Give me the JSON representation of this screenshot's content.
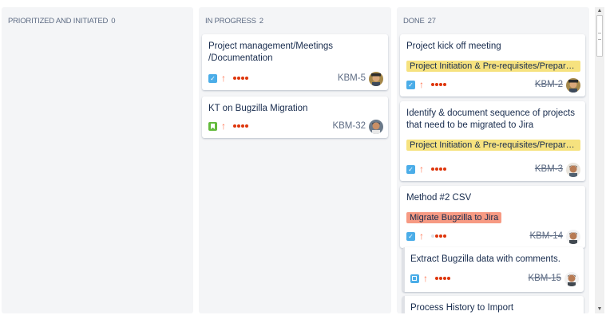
{
  "columns": [
    {
      "title": "PRIORITIZED AND INITIATED",
      "count": "0"
    },
    {
      "title": "IN PROGRESS",
      "count": "2"
    },
    {
      "title": "DONE",
      "count": "27"
    }
  ],
  "in_progress_cards": [
    {
      "title": "Project management/Meetings /Documentation",
      "key": "KBM-5",
      "type": "task-icon",
      "priority": "major-priority-arrow-icon",
      "estimate_dots": 4
    },
    {
      "title": "KT on Bugzilla Migration",
      "key": "KBM-32",
      "type": "story-icon",
      "priority": "major-priority-arrow-icon",
      "estimate_dots": 4
    }
  ],
  "done_cards": [
    {
      "title": "Project kick off meeting",
      "epic": "Project Initiation & Pre-requisites/Preparation",
      "epic_color": "#f6e27f",
      "key": "KBM-2",
      "estimate_dots": 4
    },
    {
      "title": "Identify & document sequence of projects that need to be migrated to Jira",
      "epic": "Project Initiation & Pre-requisites/Preparation",
      "epic_color": "#f6e27f",
      "key": "KBM-3",
      "estimate_dots": 4
    },
    {
      "title": "Method #2 CSV",
      "epic": "Migrate Bugzilla to Jira",
      "epic_color": "#f79a83",
      "key": "KBM-14",
      "estimate_dots": 3
    },
    {
      "title": "Extract Bugzilla data with comments.",
      "key": "KBM-15",
      "estimate_dots": 4
    },
    {
      "title": "Process History to Import"
    }
  ],
  "colors": {
    "column_bg": "#f4f5f7",
    "priority": "#ff7452",
    "estimate": "#de350b",
    "task_icon": "#4bade8",
    "story_icon": "#63ba3c"
  }
}
